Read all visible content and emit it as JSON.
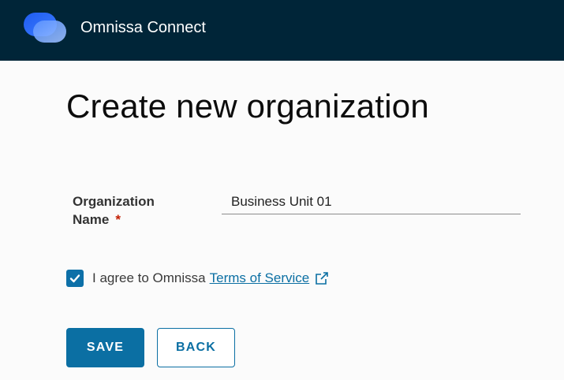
{
  "header": {
    "app_title": "Omnissa Connect",
    "logo_icon": "omnissa-logo-icon"
  },
  "page": {
    "title": "Create new organization"
  },
  "form": {
    "org_name_label": "Organization Name",
    "required_mark": "*",
    "org_name_value": "Business Unit 01",
    "agree_checked": true,
    "agree_text": "I agree to Omnissa",
    "tos_link_text": "Terms of Service",
    "tos_icon": "external-link-icon"
  },
  "actions": {
    "save_label": "SAVE",
    "back_label": "BACK"
  },
  "colors": {
    "header_bg": "#002538",
    "primary": "#0b6fa3",
    "required": "#c21d00"
  }
}
